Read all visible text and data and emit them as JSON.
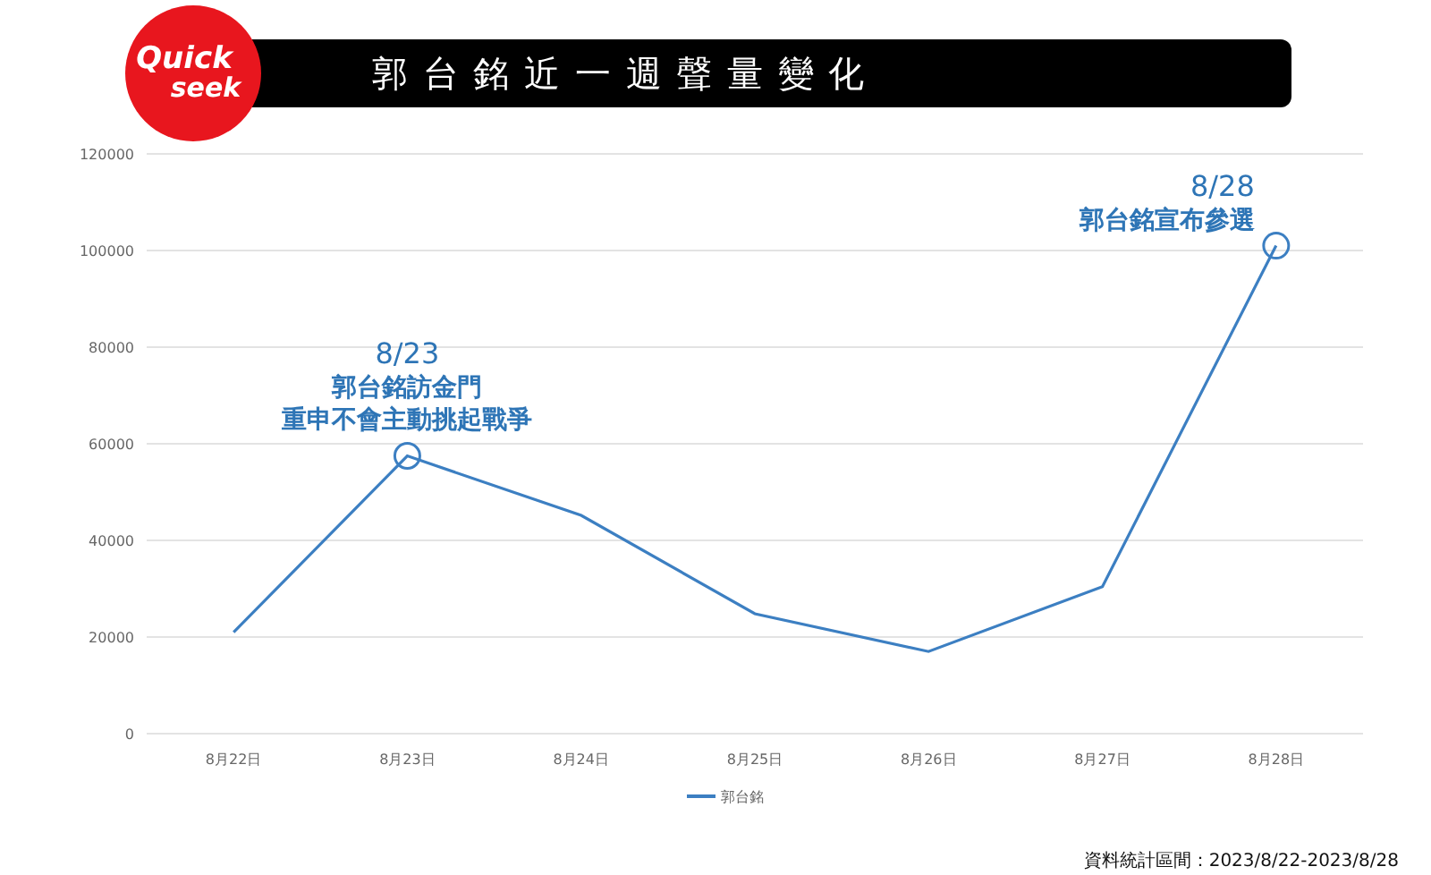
{
  "logo": {
    "line_1": "Quick",
    "line_2": "seek"
  },
  "title": "郭 台 銘 近 一 週 聲 量 變 化",
  "chart_data": {
    "type": "line",
    "categories": [
      "8月22日",
      "8月23日",
      "8月24日",
      "8月25日",
      "8月26日",
      "8月27日",
      "8月28日"
    ],
    "series": [
      {
        "name": "郭台銘",
        "color": "#3c7fc2",
        "values": [
          21000,
          57500,
          45200,
          24800,
          17000,
          30400,
          101000
        ]
      }
    ],
    "ylim": [
      0,
      120000
    ],
    "yticks": [
      0,
      20000,
      40000,
      60000,
      80000,
      100000,
      120000
    ],
    "grid": true,
    "annotations": [
      {
        "x": "8月23日",
        "y": 57500,
        "text": "8/23"
      },
      {
        "x": "8月23日",
        "y": 57500,
        "text": "郭台銘訪金門"
      },
      {
        "x": "8月23日",
        "y": 57500,
        "text": "重申不會主動挑起戰爭"
      },
      {
        "x": "8月28日",
        "y": 101000,
        "text": "8/28"
      },
      {
        "x": "8月28日",
        "y": 101000,
        "text": "郭台銘宣布參選"
      }
    ]
  },
  "footnote": "資料統計區間：2023/8/22-2023/8/28"
}
